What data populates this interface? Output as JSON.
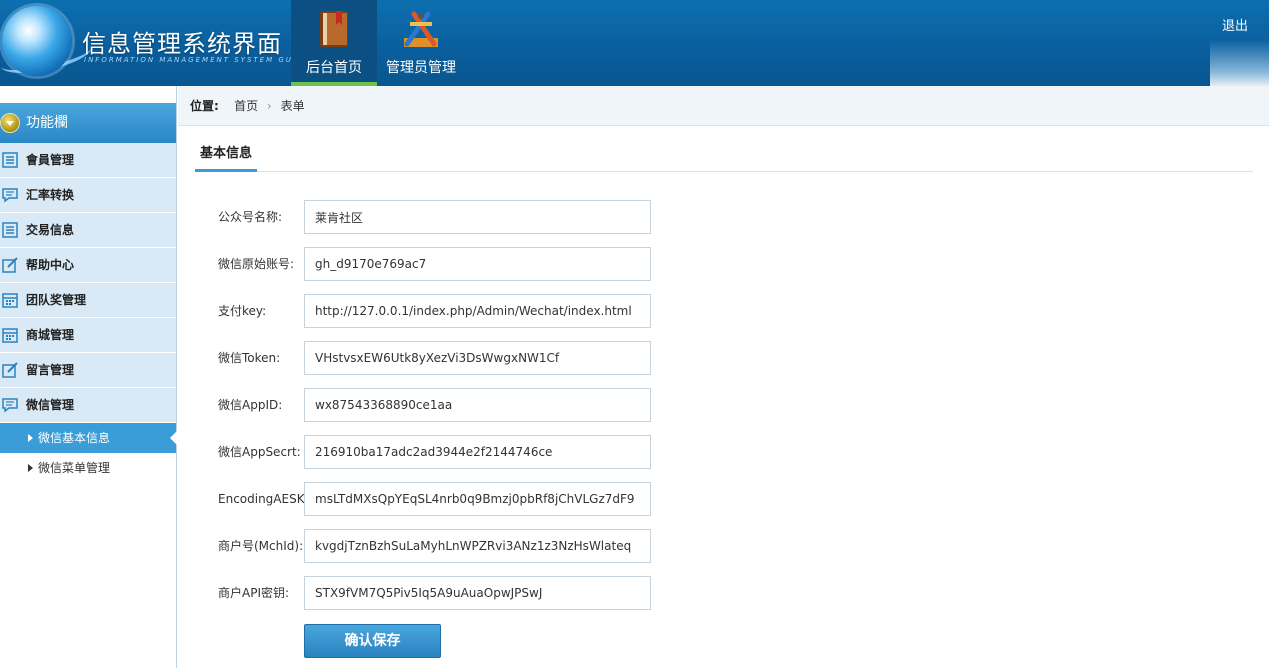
{
  "header": {
    "title": "信息管理系统界面",
    "subtitle": "INFORMATION MANAGEMENT SYSTEM GUI",
    "logout_label": "退出",
    "nav": [
      {
        "label": "后台首页",
        "icon": "book-icon",
        "active": true
      },
      {
        "label": "管理员管理",
        "icon": "tools-icon",
        "active": false
      }
    ]
  },
  "sidebar": {
    "header_label": "功能欄",
    "items": [
      {
        "label": "會員管理",
        "icon": "list-icon"
      },
      {
        "label": "汇率转换",
        "icon": "chat-icon"
      },
      {
        "label": "交易信息",
        "icon": "list-icon"
      },
      {
        "label": "帮助中心",
        "icon": "edit-icon"
      },
      {
        "label": "团队奖管理",
        "icon": "calendar-icon"
      },
      {
        "label": "商城管理",
        "icon": "calendar-icon"
      },
      {
        "label": "留言管理",
        "icon": "edit-icon"
      },
      {
        "label": "微信管理",
        "icon": "chat-icon"
      }
    ],
    "sub_items": [
      {
        "label": "微信基本信息",
        "active": true
      },
      {
        "label": "微信菜单管理",
        "active": false
      }
    ]
  },
  "breadcrumb": {
    "label": "位置:",
    "items": [
      "首页",
      "表单"
    ]
  },
  "tab": {
    "label": "基本信息"
  },
  "form": {
    "fields": [
      {
        "label": "公众号名称:",
        "value": "莱肯社区"
      },
      {
        "label": "微信原始账号:",
        "value": "gh_d9170e769ac7"
      },
      {
        "label": "支付key:",
        "value": "http://127.0.0.1/index.php/Admin/Wechat/index.html"
      },
      {
        "label": "微信Token:",
        "value": "VHstvsxEW6Utk8yXezVi3DsWwgxNW1Cf"
      },
      {
        "label": "微信AppID:",
        "value": "wx87543368890ce1aa"
      },
      {
        "label": "微信AppSecrt:",
        "value": "216910ba17adc2ad3944e2f2144746ce"
      },
      {
        "label": "EncodingAESKey:",
        "value": "msLTdMXsQpYEqSL4nrb0q9Bmzj0pbRf8jChVLGz7dF9"
      },
      {
        "label": "商户号(MchId):",
        "value": "kvgdjTznBzhSuLaMyhLnWPZRvi3ANz1z3NzHsWlateq"
      },
      {
        "label": "商户API密钥:",
        "value": "STX9fVM7Q5Piv5Iq5A9uAuaOpwJPSwJ"
      }
    ],
    "save_label": "确认保存"
  },
  "colors": {
    "header_bg": "#0a5f9e",
    "accent": "#3a9dd8",
    "active_nav_bar": "#6cc24a",
    "sidebar_item_bg": "#d9eaf6"
  }
}
